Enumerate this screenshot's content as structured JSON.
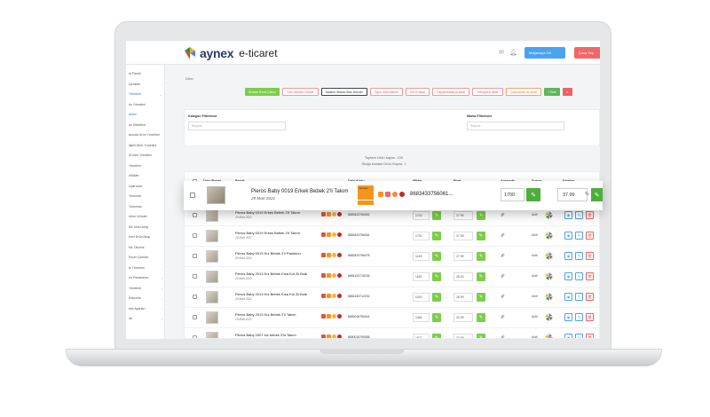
{
  "logo": {
    "brand": "aynex",
    "sub": "e-ticaret"
  },
  "topbar": {
    "store_label": "Mağazaya Git",
    "exit_label": "Çıkış Yap"
  },
  "sidebar": {
    "items": [
      {
        "label": "al Paneli",
        "arrow": ""
      },
      {
        "label": "İçerikleri",
        "arrow": "›"
      },
      {
        "label": "Yönetimi",
        "arrow": "⌄",
        "active": true
      },
      {
        "label": "ün Yönetimi",
        "arrow": ""
      },
      {
        "label": "ünleri",
        "arrow": "",
        "active": true
      },
      {
        "label": "ün Etiketleri",
        "arrow": ""
      },
      {
        "label": "asında Ürün Yönetimi",
        "arrow": ""
      },
      {
        "label": "lişkili Ürün Yönetimi",
        "arrow": ""
      },
      {
        "label": "ili Ürün Yönetimi",
        "arrow": ""
      },
      {
        "label": "Yönetimi",
        "arrow": ""
      },
      {
        "label": "ortlikler",
        "arrow": ""
      },
      {
        "label": "Uyarıcılar",
        "arrow": ""
      },
      {
        "label": "Yorumlar",
        "arrow": ""
      },
      {
        "label": "Yorumları",
        "arrow": ""
      },
      {
        "label": "rülen Ürünler",
        "arrow": ""
      },
      {
        "label": "ML Ürün Akışı",
        "arrow": ""
      },
      {
        "label": "enel Ürün Akışı",
        "arrow": ""
      },
      {
        "label": "ML Okuma",
        "arrow": ""
      },
      {
        "label": "Excel Çıktıları",
        "arrow": ""
      },
      {
        "label": "iş Yönetimi",
        "arrow": "›"
      },
      {
        "label": "eri Pazarlama",
        "arrow": "›"
      },
      {
        "label": "Yönetimi",
        "arrow": "›"
      },
      {
        "label": "Raporlar",
        "arrow": "›"
      },
      {
        "label": "ses Ayarları",
        "arrow": "›"
      },
      {
        "label": "lar",
        "arrow": "›"
      }
    ]
  },
  "breadcrumb": "Ürün",
  "buttons": [
    {
      "label": "Ürünler Excel Çıktısı",
      "style": "green"
    },
    {
      "label": "Tüm Ürünleri Göster",
      "style": "red"
    },
    {
      "label": "Sadece Stokta Olan Ürünler",
      "style": "dark"
    },
    {
      "label": "Toplu Güncelleme",
      "style": "red"
    },
    {
      "label": "N11'e Aktar",
      "style": "red"
    },
    {
      "label": "Hepsiburada'ya Aktar",
      "style": "red"
    },
    {
      "label": "Trendyol'a Aktar",
      "style": "red"
    },
    {
      "label": "Çiçeksepeti'ne Aktar",
      "style": "orange"
    },
    {
      "label": "+ Ekle",
      "style": "gsolid"
    },
    {
      "label": "✕",
      "style": "rsolid"
    }
  ],
  "filters": {
    "category_label": "Kategori Filtreleme",
    "category_placeholder": "Seçiniz",
    "brand_label": "Marka Filtreleme",
    "brand_placeholder": "Seçiniz"
  },
  "info": {
    "line1": "Toplam Ürün sayısı: 100",
    "line2_prefix": "Stoğu Azalan Ürün Sayısı:",
    "line2_value": "1"
  },
  "table": {
    "headers": [
      "Ürün Resmi",
      "Başlık",
      "Ürün Kodu",
      "Miktar",
      "Fiyat",
      "Anasayfa",
      "Durum",
      "İşlemler"
    ],
    "filter_button": "Filtrele",
    "rows": [
      {
        "title": "Pieros Baby 0019 Erkek Bebek 2'li Takım",
        "date": "29 Mart 2021",
        "barcode": "8683433756061",
        "qty": "1700",
        "price": "37.99",
        "status": "Aktif"
      },
      {
        "title": "Pieros Baby 0019 Erkek Bebek 2'li Takım",
        "date": "29 Mart 2021",
        "barcode": "8683433756061",
        "qty": "1700",
        "price": "37.99",
        "status": "Aktif"
      },
      {
        "title": "Pieros Baby 0019 Kız Bebek 2'li Pantolon",
        "date": "29 Mart 2021",
        "barcode": "8683433756078",
        "qty": "1145",
        "price": "27.99",
        "status": "Aktif"
      },
      {
        "title": "Pieros Baby 2013 Kız Bebek Kısa Kol 2li Bodi",
        "date": "29 Mart 2021",
        "barcode": "8681433715226",
        "qty": "1150",
        "price": "28.00",
        "status": "Aktif"
      },
      {
        "title": "Pieros Baby 2013 Kız Bebek Kısa Kol 2li Bodi",
        "date": "29 Mart 2021",
        "barcode": "8681433712232",
        "qty": "1003",
        "price": "28.99",
        "status": "Aktif"
      },
      {
        "title": "Pieros Baby 2013 Kız Bebek 2'li Takım",
        "date": "19 Mart 2021",
        "barcode": "8690016790041",
        "qty": "1464",
        "price": "32.99",
        "status": "Aktif"
      },
      {
        "title": "Pieros Baby 2007 kız bebek 3'lü Takım",
        "date": "19 Mart 2021",
        "barcode": "8690016790058",
        "qty": "1577",
        "price": "33.99",
        "status": "Aktif"
      },
      {
        "title": "Pieros Baby 2013 kız bebek 3'lü takım",
        "date": "19 Mart 2021",
        "barcode": "8690716790232",
        "qty": "1388",
        "price": "38.99",
        "status": "Aktif"
      }
    ]
  },
  "popup_row": {
    "title": "Pieros Baby 0019 Erkek Bebek 2'li Takım",
    "date": "29 Mart 2021",
    "barcode": "8683433756061...",
    "qty": "1700",
    "price": "37.99",
    "percent": "%",
    "badge": "trendyol"
  }
}
